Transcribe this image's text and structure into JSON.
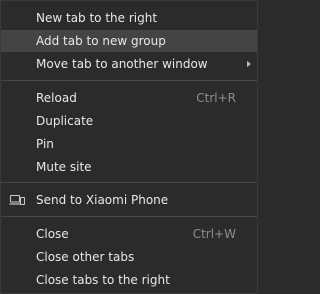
{
  "context_menu": {
    "tab_section": {
      "new_tab_right": "New tab to the right",
      "add_to_group": "Add tab to new group",
      "move_to_window": "Move tab to another window"
    },
    "page_section": {
      "reload": "Reload",
      "reload_shortcut": "Ctrl+R",
      "duplicate": "Duplicate",
      "pin": "Pin",
      "mute_site": "Mute site"
    },
    "device_section": {
      "send_to_device": "Send to Xiaomi Phone",
      "device_icon": "laptop-phone-icon"
    },
    "close_section": {
      "close": "Close",
      "close_shortcut": "Ctrl+W",
      "close_other": "Close other tabs",
      "close_right": "Close tabs to the right"
    },
    "highlighted_item": "add_to_group",
    "colors": {
      "background": "#2b2b2b",
      "highlight": "#444444",
      "text": "#e8e8e8",
      "shortcut_text": "#8e8e8e",
      "separator": "#474747"
    }
  }
}
